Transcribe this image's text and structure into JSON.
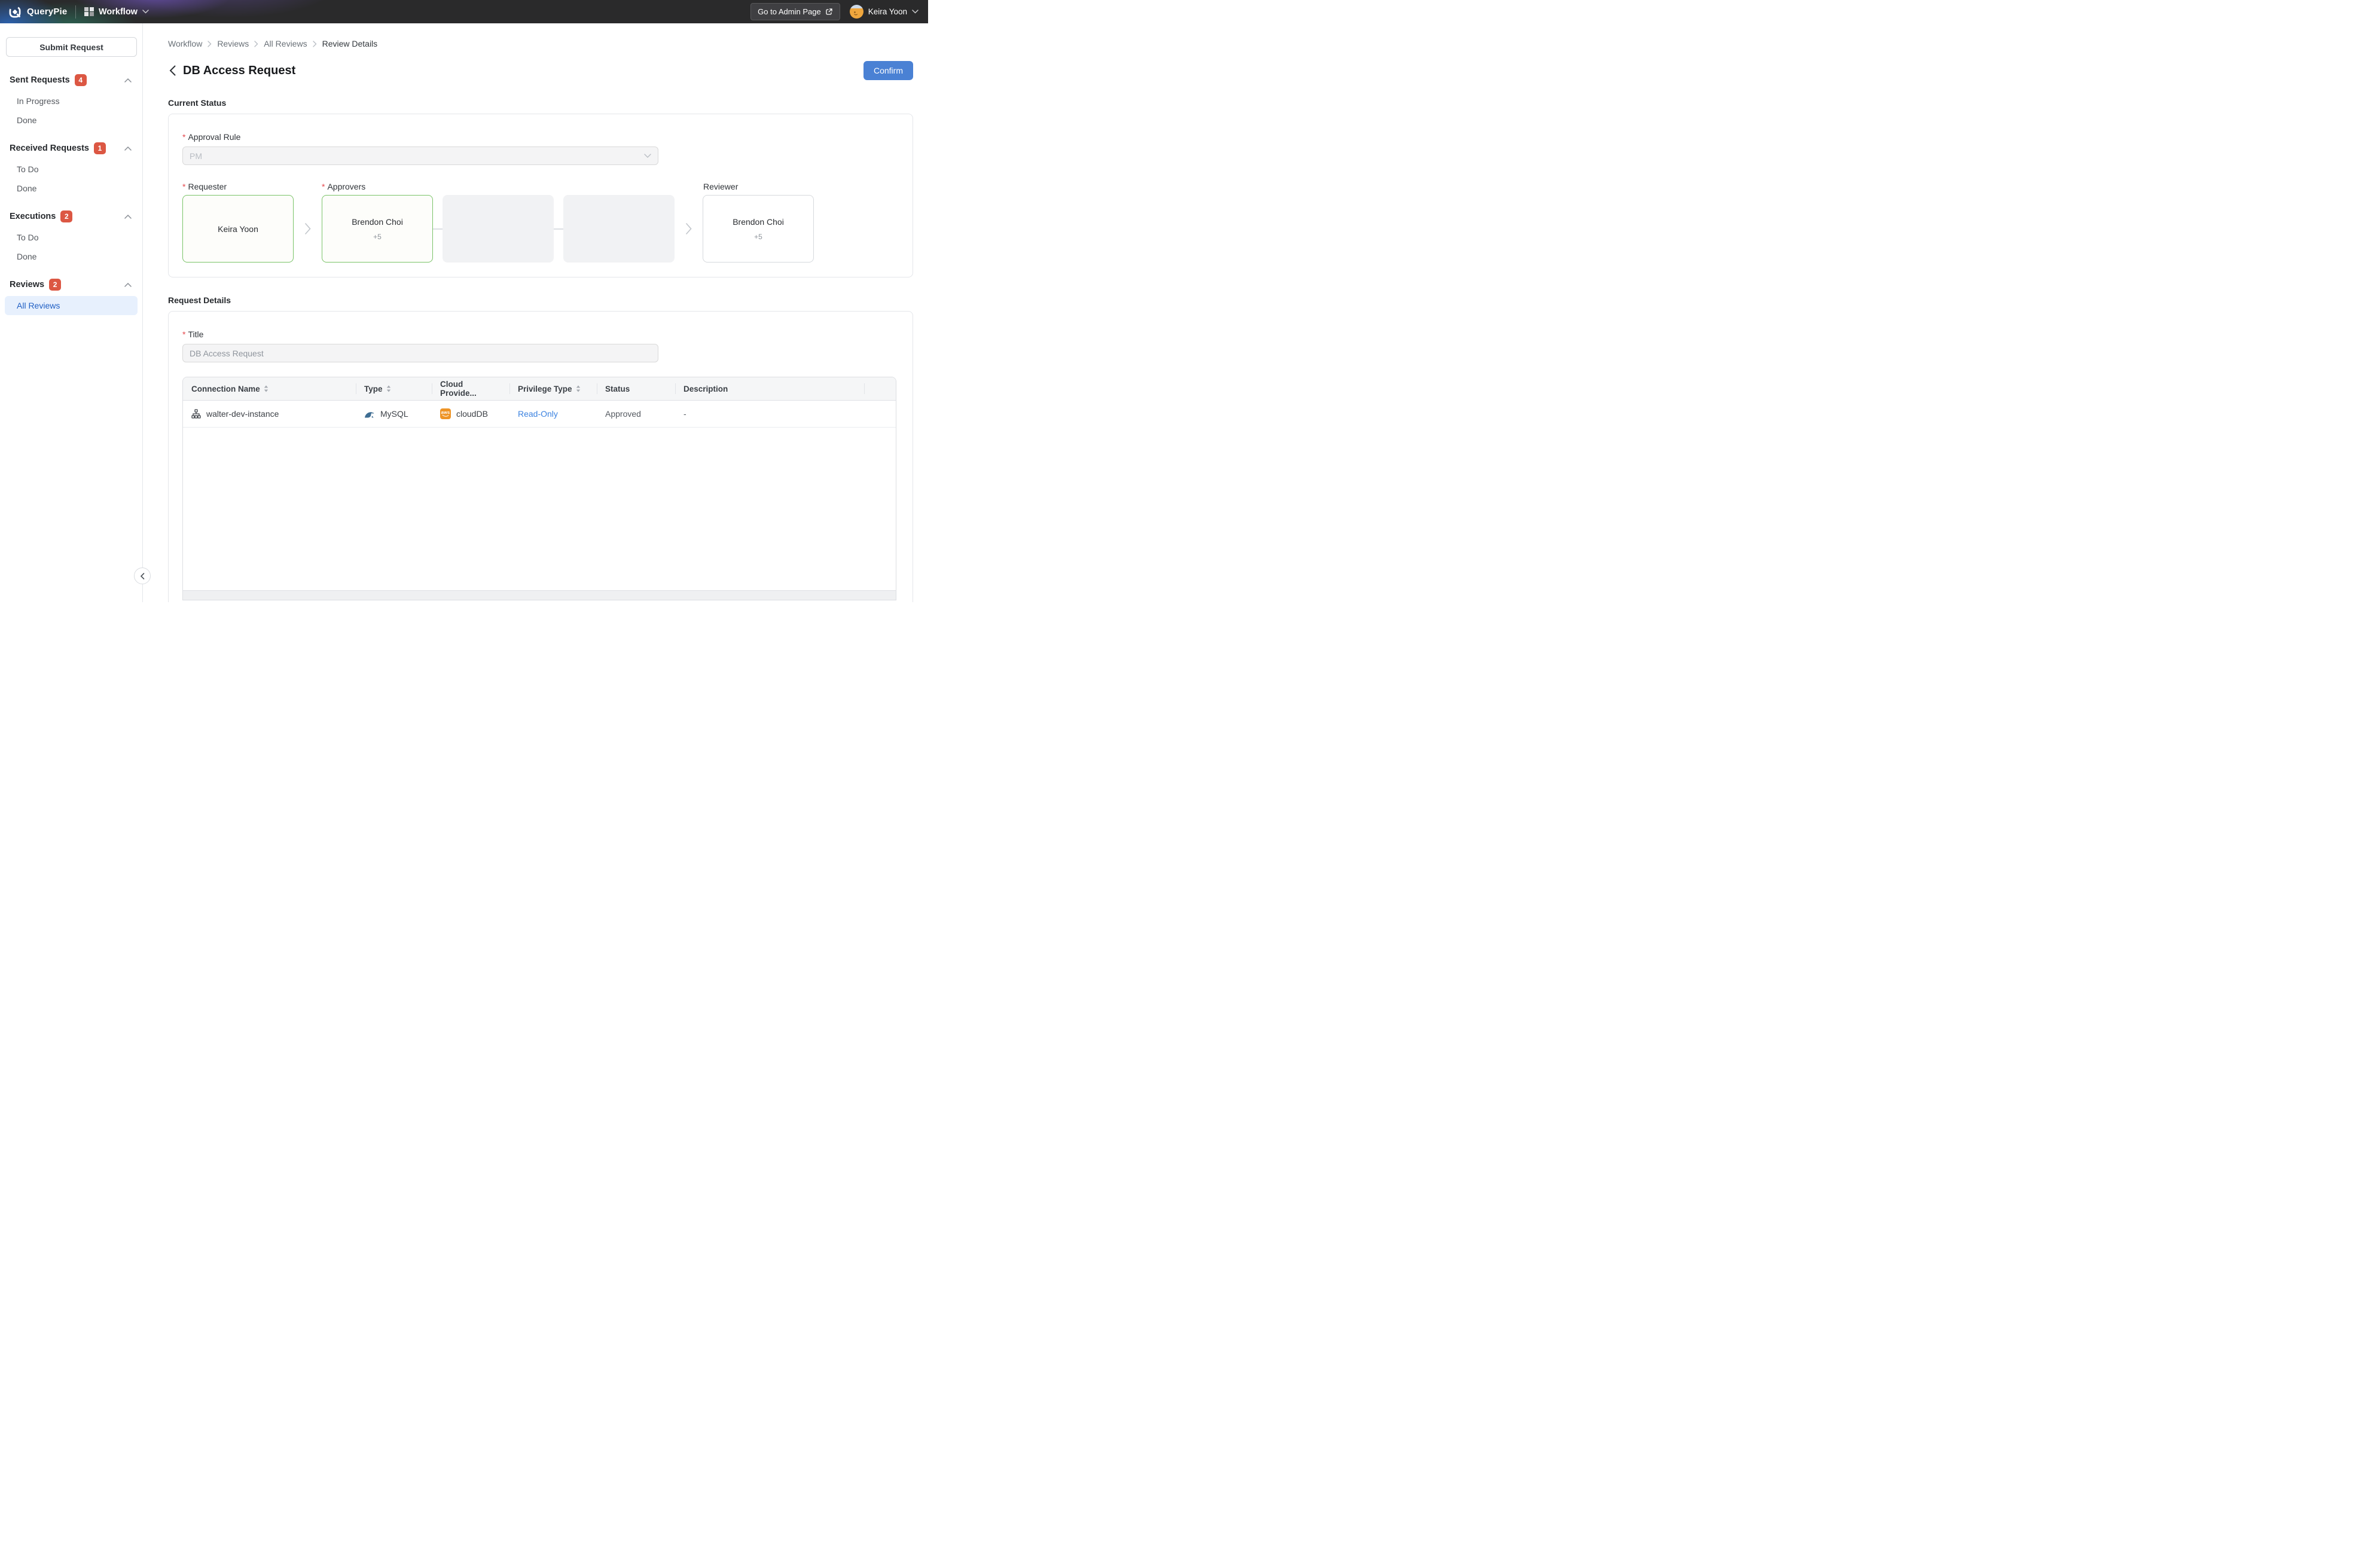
{
  "topbar": {
    "brand": "QueryPie",
    "app_name": "Workflow",
    "admin_button_label": "Go to Admin Page",
    "user_name": "Keira Yoon"
  },
  "sidebar": {
    "submit_button_label": "Submit Request",
    "sections": [
      {
        "label": "Sent Requests",
        "badge": "4",
        "items": [
          {
            "label": "In Progress"
          },
          {
            "label": "Done"
          }
        ]
      },
      {
        "label": "Received Requests",
        "badge": "1",
        "items": [
          {
            "label": "To Do"
          },
          {
            "label": "Done"
          }
        ]
      },
      {
        "label": "Executions",
        "badge": "2",
        "items": [
          {
            "label": "To Do"
          },
          {
            "label": "Done"
          }
        ]
      },
      {
        "label": "Reviews",
        "badge": "2",
        "items": [
          {
            "label": "All Reviews",
            "selected": true
          }
        ]
      }
    ]
  },
  "breadcrumb": {
    "items": [
      "Workflow",
      "Reviews",
      "All Reviews",
      "Review Details"
    ]
  },
  "page": {
    "title": "DB Access Request",
    "confirm_button_label": "Confirm"
  },
  "current_status": {
    "heading": "Current Status",
    "approval_rule_label": "Approval Rule",
    "approval_rule_value": "PM",
    "requester_label": "Requester",
    "requester_name": "Keira Yoon",
    "approvers_label": "Approvers",
    "approver_name": "Brendon Choi",
    "approver_extra": "+5",
    "reviewer_label": "Reviewer",
    "reviewer_name": "Brendon Choi",
    "reviewer_extra": "+5"
  },
  "request_details": {
    "heading": "Request Details",
    "title_label": "Title",
    "title_value": "DB Access Request",
    "table": {
      "columns": [
        {
          "label": "Connection Name",
          "sortable": true
        },
        {
          "label": "Type",
          "sortable": true
        },
        {
          "label": "Cloud Provide...",
          "sortable": false
        },
        {
          "label": "Privilege Type",
          "sortable": true
        },
        {
          "label": "Status",
          "sortable": false
        },
        {
          "label": "Description",
          "sortable": false
        }
      ],
      "rows": [
        {
          "connection_name": "walter-dev-instance",
          "type": "MySQL",
          "cloud_provider": "cloudDB",
          "provider_icon": "aws-icon",
          "provider_icon_word": "aws",
          "privilege_type": "Read-Only",
          "status": "Approved",
          "description": "-"
        }
      ]
    }
  },
  "colors": {
    "accent_blue": "#4a81d4",
    "badge_red": "#dc5743",
    "link_blue": "#3b82e0",
    "approved_path_green": "#7ac368",
    "aws_orange": "#ee9426",
    "selected_nav_bg": "#e7f0fd",
    "selected_nav_text": "#2160c4",
    "topbar_bg": "#2a2a2b"
  }
}
